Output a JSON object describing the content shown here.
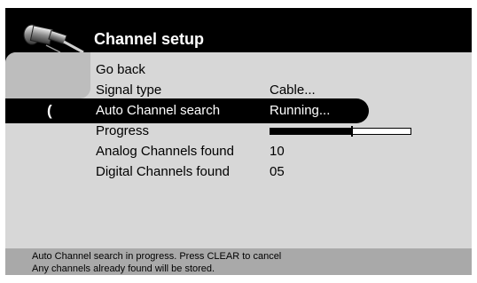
{
  "header": {
    "title": "Channel setup",
    "logo_icon": "cable-connector-icon"
  },
  "menu": {
    "items": [
      {
        "label": "Go back",
        "value": ""
      },
      {
        "label": "Signal type",
        "value": "Cable..."
      },
      {
        "label": "Auto Channel search",
        "value": "Running..."
      },
      {
        "label": "Progress",
        "value": ""
      },
      {
        "label": "Analog Channels found",
        "value": "10"
      },
      {
        "label": "Digital Channels found",
        "value": "05"
      }
    ],
    "selected_index": 2,
    "cursor_glyph": "("
  },
  "progress": {
    "fraction": 0.58
  },
  "footer": {
    "line1": "Auto Channel search in progress. Press CLEAR to cancel",
    "line2": "Any channels already found will be stored."
  },
  "colors": {
    "background": "#000000",
    "panel": "#d7d7d7",
    "footer": "#a9a9a9",
    "highlight": "#000000",
    "highlight_text": "#ffffff"
  }
}
